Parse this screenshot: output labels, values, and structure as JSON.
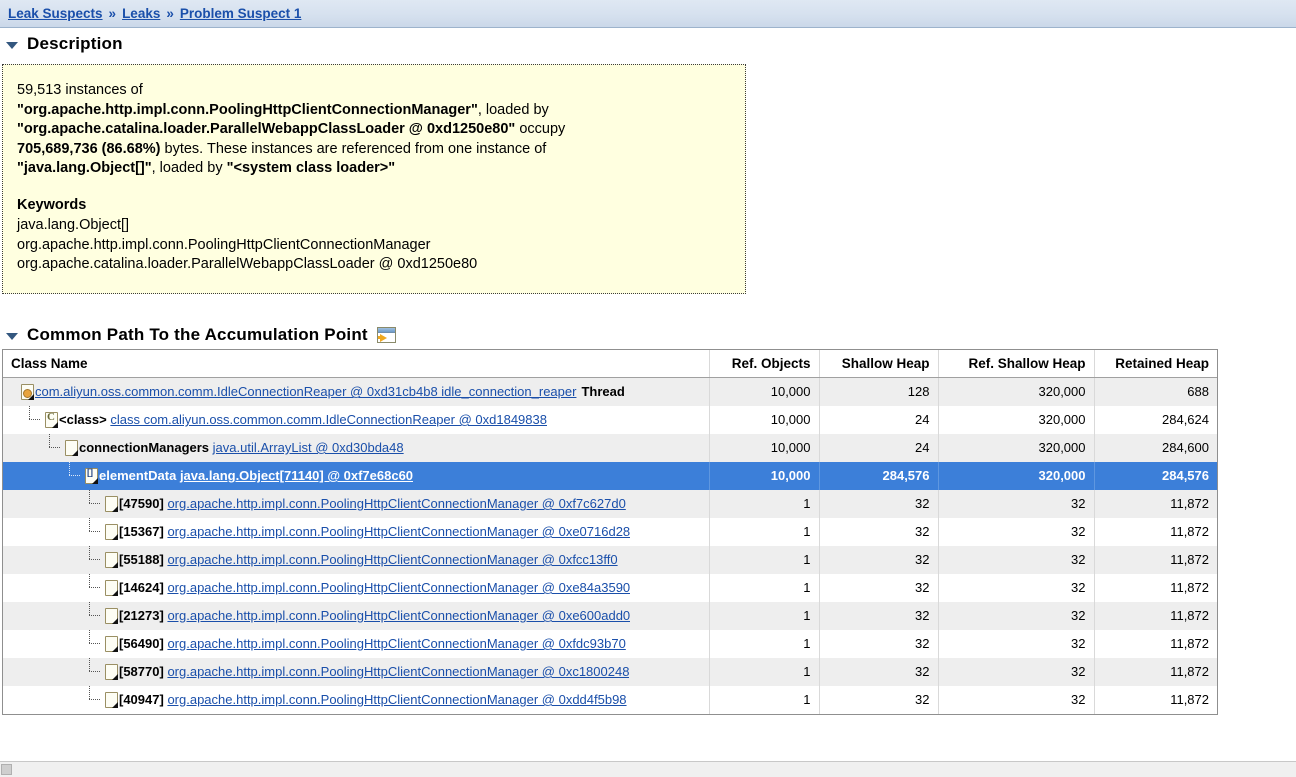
{
  "breadcrumb": {
    "items": [
      {
        "label": "Leak Suspects"
      },
      {
        "label": "Leaks"
      },
      {
        "label": "Problem Suspect 1"
      }
    ],
    "separator": "»"
  },
  "description_section": {
    "title": "Description",
    "twisty_icon": "triangle-down-icon",
    "body": {
      "line1_prefix": "59,513 instances of",
      "class_name": "\"org.apache.http.impl.conn.PoolingHttpClientConnectionManager\"",
      "loaded_by_text": ", loaded by",
      "classloader": "\"org.apache.catalina.loader.ParallelWebappClassLoader @ 0xd1250e80\"",
      "occupy_text": " occupy",
      "bytes": "705,689,736 (86.68%)",
      "bytes_tail": " bytes. These instances are referenced from one instance of",
      "ref_class": "\"java.lang.Object[]\"",
      "ref_loaded_by": ", loaded by ",
      "ref_classloader": "\"<system class loader>\""
    },
    "keywords_heading": "Keywords",
    "keywords": [
      "java.lang.Object[]",
      "org.apache.http.impl.conn.PoolingHttpClientConnectionManager",
      "org.apache.catalina.loader.ParallelWebappClassLoader @ 0xd1250e80"
    ]
  },
  "accumulation_section": {
    "title": "Common Path To the Accumulation Point",
    "twisty_icon": "triangle-down-icon",
    "export_icon": "open-in-window-icon"
  },
  "table": {
    "columns": [
      {
        "key": "name",
        "label": "Class Name",
        "align": "left"
      },
      {
        "key": "ref_objects",
        "label": "Ref. Objects",
        "align": "right"
      },
      {
        "key": "shallow_heap",
        "label": "Shallow Heap",
        "align": "right"
      },
      {
        "key": "ref_shallow_heap",
        "label": "Ref. Shallow Heap",
        "align": "right"
      },
      {
        "key": "retained_heap",
        "label": "Retained Heap",
        "align": "right"
      }
    ],
    "rows": [
      {
        "depth": 0,
        "icon": "thread-object-icon",
        "prefix": "",
        "link": "com.aliyun.oss.common.comm.IdleConnectionReaper @ 0xd31cb4b8 idle_connection_reaper",
        "suffix": "Thread",
        "ref_objects": "10,000",
        "shallow_heap": "128",
        "ref_shallow_heap": "320,000",
        "retained_heap": "688",
        "style": "alt",
        "selected": false
      },
      {
        "depth": 1,
        "icon": "class-object-icon",
        "prefix": "<class>",
        "link": "class com.aliyun.oss.common.comm.IdleConnectionReaper @ 0xd1849838",
        "suffix": "",
        "ref_objects": "10,000",
        "shallow_heap": "24",
        "ref_shallow_heap": "320,000",
        "retained_heap": "284,624",
        "style": "plain",
        "selected": false
      },
      {
        "depth": 2,
        "icon": "object-icon",
        "prefix": "connectionManagers",
        "link": "java.util.ArrayList @ 0xd30bda48",
        "suffix": "",
        "ref_objects": "10,000",
        "shallow_heap": "24",
        "ref_shallow_heap": "320,000",
        "retained_heap": "284,600",
        "style": "alt",
        "selected": false
      },
      {
        "depth": 3,
        "icon": "array-object-icon",
        "prefix": "elementData",
        "link": "java.lang.Object[71140] @ 0xf7e68c60",
        "suffix": "",
        "ref_objects": "10,000",
        "shallow_heap": "284,576",
        "ref_shallow_heap": "320,000",
        "retained_heap": "284,576",
        "style": "plain",
        "selected": true
      },
      {
        "depth": 4,
        "icon": "object-icon",
        "prefix": "[47590]",
        "link": "org.apache.http.impl.conn.PoolingHttpClientConnectionManager @ 0xf7c627d0",
        "suffix": "",
        "ref_objects": "1",
        "shallow_heap": "32",
        "ref_shallow_heap": "32",
        "retained_heap": "11,872",
        "style": "alt",
        "selected": false
      },
      {
        "depth": 4,
        "icon": "object-icon",
        "prefix": "[15367]",
        "link": "org.apache.http.impl.conn.PoolingHttpClientConnectionManager @ 0xe0716d28",
        "suffix": "",
        "ref_objects": "1",
        "shallow_heap": "32",
        "ref_shallow_heap": "32",
        "retained_heap": "11,872",
        "style": "plain",
        "selected": false
      },
      {
        "depth": 4,
        "icon": "object-icon",
        "prefix": "[55188]",
        "link": "org.apache.http.impl.conn.PoolingHttpClientConnectionManager @ 0xfcc13ff0",
        "suffix": "",
        "ref_objects": "1",
        "shallow_heap": "32",
        "ref_shallow_heap": "32",
        "retained_heap": "11,872",
        "style": "alt",
        "selected": false
      },
      {
        "depth": 4,
        "icon": "object-icon",
        "prefix": "[14624]",
        "link": "org.apache.http.impl.conn.PoolingHttpClientConnectionManager @ 0xe84a3590",
        "suffix": "",
        "ref_objects": "1",
        "shallow_heap": "32",
        "ref_shallow_heap": "32",
        "retained_heap": "11,872",
        "style": "plain",
        "selected": false
      },
      {
        "depth": 4,
        "icon": "object-icon",
        "prefix": "[21273]",
        "link": "org.apache.http.impl.conn.PoolingHttpClientConnectionManager @ 0xe600add0",
        "suffix": "",
        "ref_objects": "1",
        "shallow_heap": "32",
        "ref_shallow_heap": "32",
        "retained_heap": "11,872",
        "style": "alt",
        "selected": false
      },
      {
        "depth": 4,
        "icon": "object-icon",
        "prefix": "[56490]",
        "link": "org.apache.http.impl.conn.PoolingHttpClientConnectionManager @ 0xfdc93b70",
        "suffix": "",
        "ref_objects": "1",
        "shallow_heap": "32",
        "ref_shallow_heap": "32",
        "retained_heap": "11,872",
        "style": "plain",
        "selected": false
      },
      {
        "depth": 4,
        "icon": "object-icon",
        "prefix": "[58770]",
        "link": "org.apache.http.impl.conn.PoolingHttpClientConnectionManager @ 0xc1800248",
        "suffix": "",
        "ref_objects": "1",
        "shallow_heap": "32",
        "ref_shallow_heap": "32",
        "retained_heap": "11,872",
        "style": "alt",
        "selected": false
      },
      {
        "depth": 4,
        "icon": "object-icon",
        "prefix": "[40947]",
        "link": "org.apache.http.impl.conn.PoolingHttpClientConnectionManager @ 0xdd4f5b98",
        "suffix": "",
        "ref_objects": "1",
        "shallow_heap": "32",
        "ref_shallow_heap": "32",
        "retained_heap": "11,872",
        "style": "plain",
        "selected": false
      }
    ]
  },
  "colors": {
    "selection": "#3c7fd9",
    "link": "#1a4faa",
    "description_bg": "#ffffe0",
    "breadcrumb_bg": "#d6e1ef",
    "row_alt": "#eeeeee"
  },
  "scrollbar": {
    "orientation": "horizontal"
  }
}
